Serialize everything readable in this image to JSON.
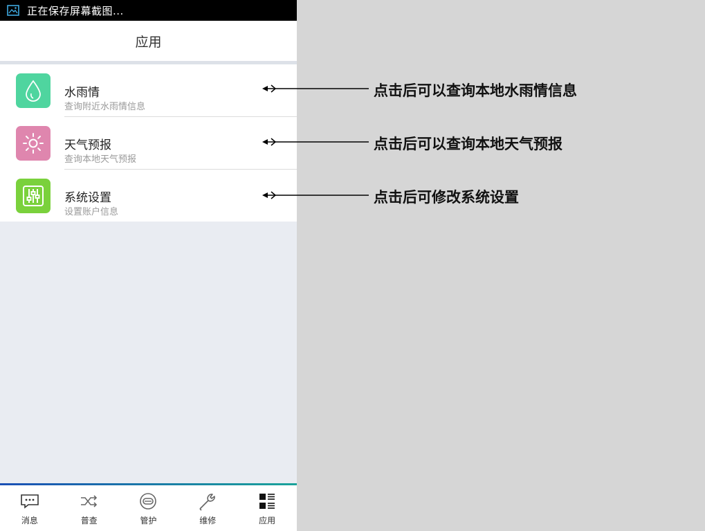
{
  "status_bar": {
    "text": "正在保存屏幕截图...",
    "icon": "screenshot-icon"
  },
  "header": {
    "title": "应用"
  },
  "apps": [
    {
      "label": "水雨情",
      "subtitle": "查询附近水雨情信息",
      "icon": "water-drop-icon",
      "color": "#4fd59f"
    },
    {
      "label": "天气预报",
      "subtitle": "查询本地天气预报",
      "icon": "sun-icon",
      "color": "#df86ae"
    },
    {
      "label": "系统设置",
      "subtitle": "设置账户信息",
      "icon": "sliders-icon",
      "color": "#7ad13c"
    }
  ],
  "tabbar": {
    "items": [
      {
        "label": "消息",
        "icon": "message-icon"
      },
      {
        "label": "普查",
        "icon": "shuffle-icon"
      },
      {
        "label": "管护",
        "icon": "pipe-icon"
      },
      {
        "label": "维修",
        "icon": "wrench-icon"
      },
      {
        "label": "应用",
        "icon": "grid-list-icon"
      }
    ],
    "accent_start": "#1a4fb5",
    "accent_end": "#1aa39a"
  },
  "annotations": [
    {
      "text": "点击后可以查询本地水雨情信息"
    },
    {
      "text": "点击后可以查询本地天气预报"
    },
    {
      "text": "点击后可修改系统设置"
    }
  ]
}
